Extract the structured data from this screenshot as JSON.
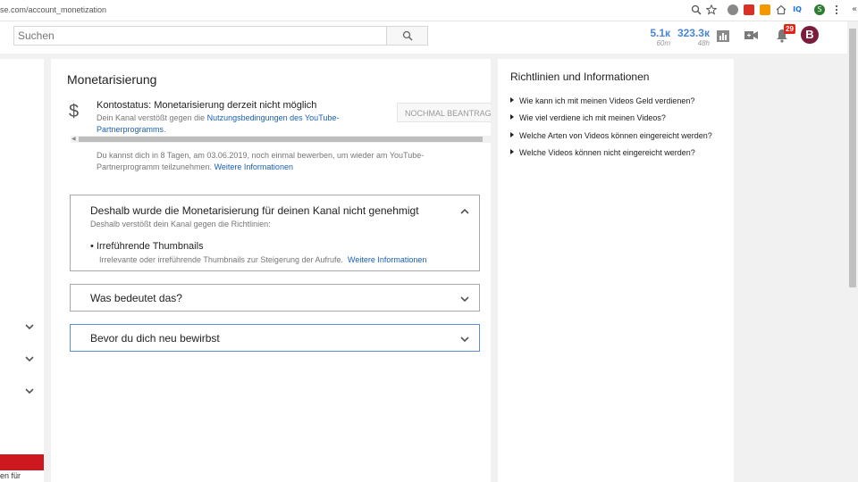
{
  "browser": {
    "url": "se.com/account_monetization",
    "extensions": [
      "zoom-icon",
      "star-icon",
      "ext-gray",
      "ext-red",
      "ext-orange",
      "home-icon",
      "iq-icon",
      "profile-s",
      "menu-icon"
    ],
    "iq_label": "IQ",
    "profile_initial": "S",
    "side_glyph": "«"
  },
  "header": {
    "search_placeholder": "Suchen",
    "stats": [
      {
        "value": "5.1к",
        "sub": "60m"
      },
      {
        "value": "323.3к",
        "sub": "48h"
      }
    ],
    "notification_count": "29",
    "avatar_letter": "B"
  },
  "sidebar": {
    "bottom_text": "en für"
  },
  "main": {
    "title": "Monetarisierung",
    "dollar_symbol": "$",
    "status_text": "Kontostatus: Monetarisierung derzeit nicht möglich",
    "violation_prefix": "Dein Kanal verstößt gegen die ",
    "violation_link": "Nutzungsbedingungen des YouTube-Partnerprogramms",
    "violation_suffix": ".",
    "reapply_button": "NOCHMAL BEANTRAGEN",
    "reapply_info": "Du kannst dich in 8 Tagen, am 03.06.2019, noch einmal bewerben, um wieder am YouTube-Partnerprogramm teilzunehmen.",
    "reapply_info_link": "Weitere Informationen",
    "accordions": [
      {
        "heading": "Deshalb wurde die Monetarisierung für deinen Kanal nicht genehmigt",
        "expanded": true,
        "subtitle": "Deshalb verstößt dein Kanal gegen die Richtlinien:",
        "bullet_title": "Irreführende Thumbnails",
        "bullet_desc": "Irrelevante oder irreführende Thumbnails zur Steigerung der Aufrufe.",
        "bullet_link": "Weitere Informationen"
      },
      {
        "heading": "Was bedeutet das?",
        "expanded": false
      },
      {
        "heading": "Bevor du dich neu bewirbst",
        "expanded": false
      }
    ]
  },
  "right_panel": {
    "title": "Richtlinien und Informationen",
    "items": [
      "Wie kann ich mit meinen Videos Geld verdienen?",
      "Wie viel verdiene ich mit meinen Videos?",
      "Welche Arten von Videos können eingereicht werden?",
      "Welche Videos können nicht eingereicht werden?"
    ]
  },
  "colors": {
    "accent_blue": "#4a86d6",
    "link_blue": "#1a5fb4",
    "youtube_red": "#cc181e",
    "avatar_bg": "#7b1c3a"
  }
}
